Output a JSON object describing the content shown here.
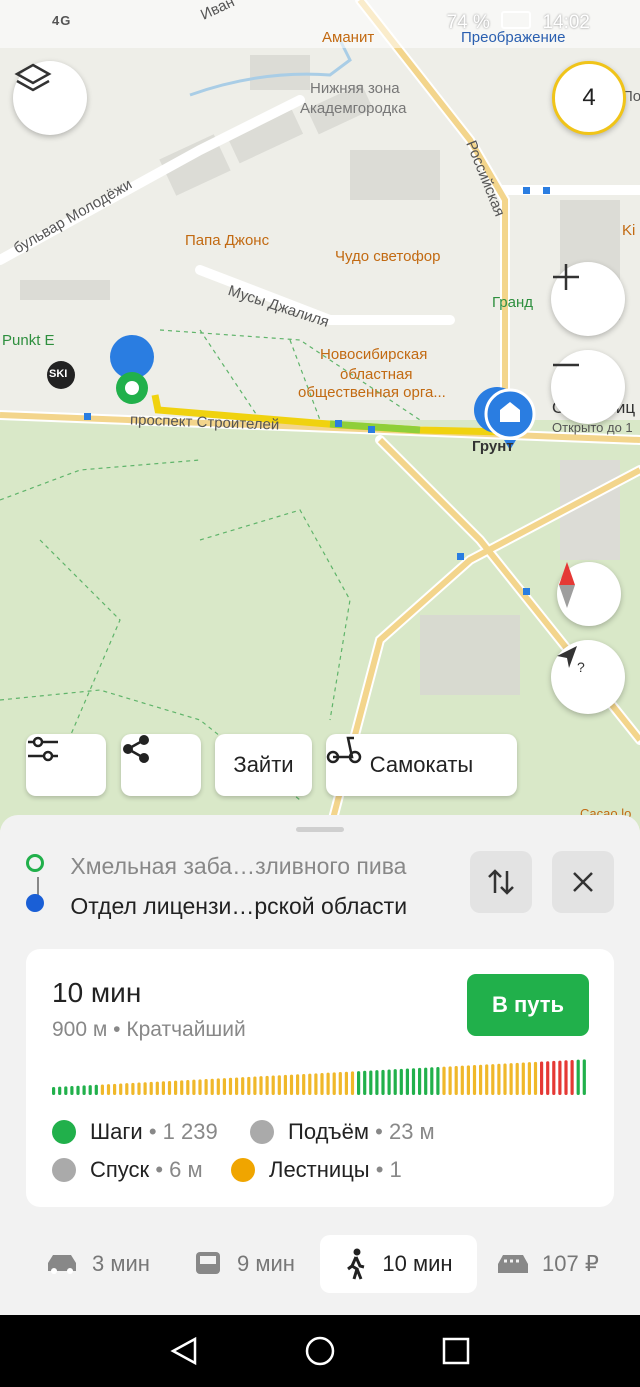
{
  "status_bar": {
    "network": "4G",
    "battery": "74 %",
    "time": "14:02"
  },
  "map": {
    "labels": {
      "amanit": "Аманит",
      "preobrazhenie": "Преображение",
      "zone_line1": "Нижняя зона",
      "zone_line2": "Академгородка",
      "rossiyskaya": "Российская",
      "bulvar": "бульвар Молодёжи",
      "papa_johns": "Папа Джонс",
      "chudo": "Чудо светофор",
      "grand": "Гранд",
      "musy": "Мусы Джалиля",
      "punkt": "Punkt E",
      "ski": "SKI",
      "org_line1": "Новосибирская",
      "org_line2": "областная",
      "org_line3": "общественная орга...",
      "prospekt": "проспект Строителей",
      "grunt": "Грунт",
      "dest_name": "Отдел лиц",
      "dest_hours": "Открыто до 1",
      "ivan": "Иван",
      "ki": "Ki",
      "pol": "Пол",
      "cacao": "Cacao lo"
    },
    "zoom_badge": "4"
  },
  "chips": {
    "filters_icon": "sliders-icon",
    "share_icon": "share-icon",
    "enter": "Зайти",
    "scooters": "Самокаты"
  },
  "route": {
    "from": "Хмельная заба…зливного пива",
    "to": "Отдел лицензи…рской области",
    "colors": {
      "from": "#21b04b",
      "to": "#1a5fd6"
    }
  },
  "result": {
    "duration": "10 мин",
    "details": "900 м • Кратчайший",
    "go_button": "В путь",
    "steps_label": "Шаги",
    "steps_value": "• 1 239",
    "ascent_label": "Подъём",
    "ascent_value": "• 23 м",
    "descent_label": "Спуск",
    "descent_value": "• 6 м",
    "stairs_label": "Лестницы",
    "stairs_value": "• 1",
    "accent": "#21b04b"
  },
  "modes": {
    "car": "3 мин",
    "bus": "9 мин",
    "walk": "10 мин",
    "taxi": "107 ₽"
  }
}
